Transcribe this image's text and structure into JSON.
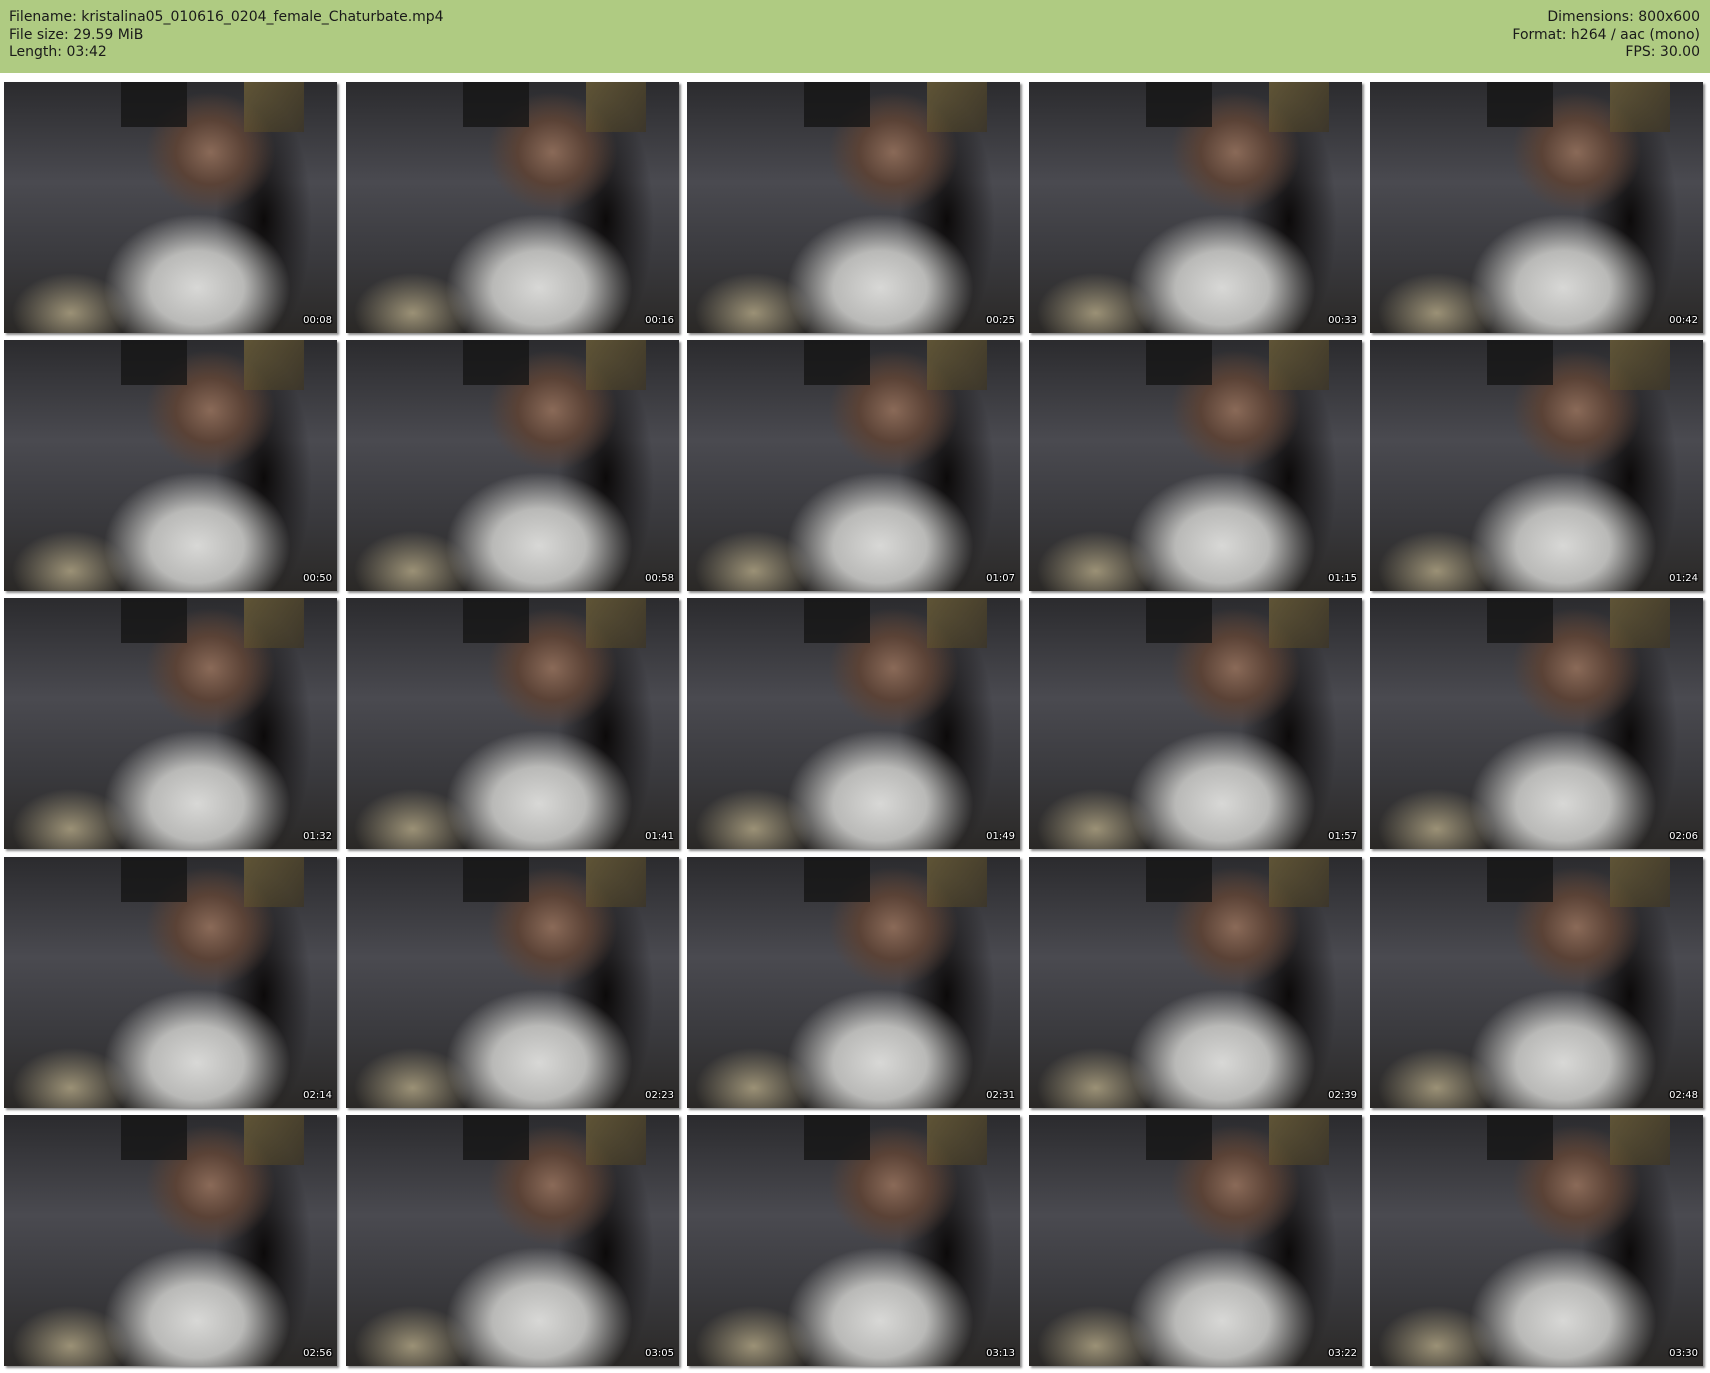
{
  "header": {
    "left": [
      "Filename: kristalina05_010616_0204_female_Chaturbate.mp4",
      "File size: 29.59 MiB",
      "Length: 03:42"
    ],
    "right": [
      "Dimensions: 800x600",
      "Format: h264 / aac (mono)",
      "FPS: 30.00"
    ]
  },
  "thumbnails": [
    "00:08",
    "00:16",
    "00:25",
    "00:33",
    "00:42",
    "00:50",
    "00:58",
    "01:07",
    "01:15",
    "01:24",
    "01:32",
    "01:41",
    "01:49",
    "01:57",
    "02:06",
    "02:14",
    "02:23",
    "02:31",
    "02:39",
    "02:48",
    "02:56",
    "03:05",
    "03:13",
    "03:22",
    "03:30"
  ],
  "colors": {
    "header_bg": "#afcb82",
    "timestamp_text": "#ffffff"
  }
}
